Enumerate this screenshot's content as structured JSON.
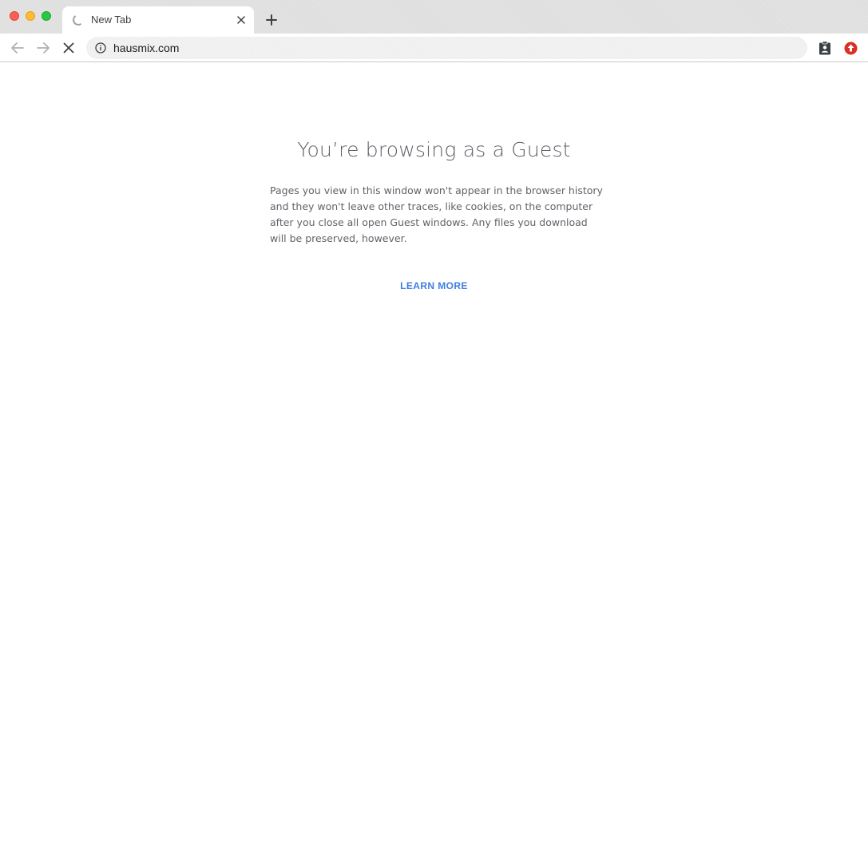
{
  "window": {
    "traffic_lights": [
      "close",
      "minimize",
      "zoom"
    ],
    "colors": {
      "close": "#fe5f57",
      "minimize": "#febc2e",
      "zoom": "#28c840"
    }
  },
  "tab": {
    "title": "New Tab",
    "icon": "loading-spinner-icon",
    "close_icon": "close-icon"
  },
  "new_tab_icon": "plus-icon",
  "toolbar": {
    "back_icon": "arrow-left-icon",
    "forward_icon": "arrow-right-icon",
    "stop_icon": "stop-x-icon",
    "omnibox": {
      "info_icon": "info-icon",
      "url": "hausmix.com"
    },
    "extensions": [
      {
        "icon": "clipboard-person-icon"
      },
      {
        "icon": "update-arrow-icon",
        "color": "#d93025"
      }
    ]
  },
  "page": {
    "title": "You’re browsing as a Guest",
    "description": "Pages you view in this window won't appear in the browser history and they won't leave other traces, like cookies, on the computer after you close all open Guest windows. Any files you download will be preserved, however.",
    "learn_more": "LEARN MORE",
    "accent_color": "#3f7ee0"
  }
}
